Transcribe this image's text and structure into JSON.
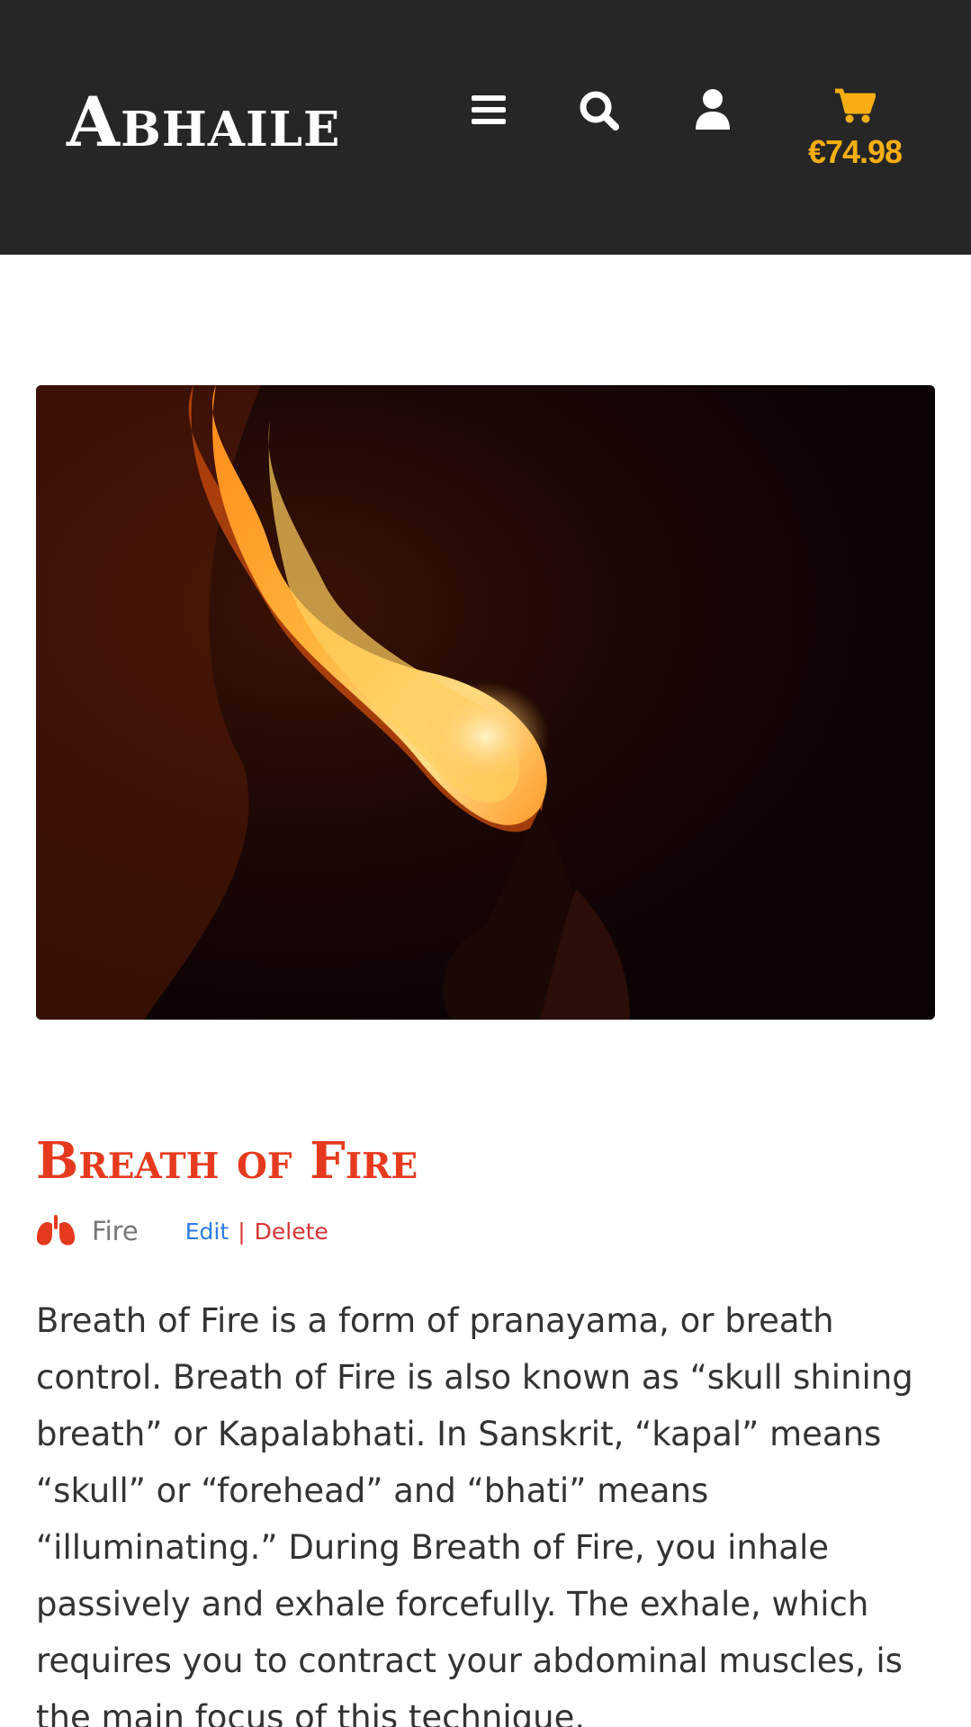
{
  "header": {
    "brand": "Abhaile",
    "cart_total": "€74.98",
    "icons": [
      "menu-icon",
      "search-icon",
      "user-icon",
      "cart-icon"
    ],
    "colors": {
      "background": "#262626",
      "cart_accent": "#f6ae12"
    }
  },
  "hero": {
    "icon": "fire-breathing-photo"
  },
  "post": {
    "title": "Breath of Fire",
    "category_icon": "lungs-icon",
    "category": "Fire",
    "edit_label": "Edit",
    "separator": "|",
    "delete_label": "Delete",
    "body": "Breath of Fire is a form of pranayama, or breath control. Breath of Fire is also known as “skull shining breath” or Kapalabhati. In Sanskrit, “kapal” means “skull” or “forehead” and “bhati” means “illuminating.” During Breath of Fire, you inhale passively and exhale forcefully. The exhale, which requires you to contract your abdominal muscles, is the main focus of this technique.",
    "colors": {
      "title": "#e63a1e",
      "edit": "#2b7ee0",
      "delete": "#d93535"
    }
  }
}
